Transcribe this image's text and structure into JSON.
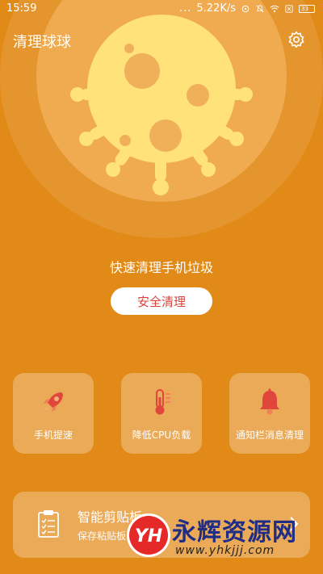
{
  "status_bar": {
    "time": "15:59",
    "dots": "...",
    "speed": "5.22K/s",
    "battery": "33"
  },
  "app": {
    "title": "清理球球"
  },
  "hero": {
    "subtitle": "快速清理手机垃圾",
    "button": "安全清理"
  },
  "features": [
    {
      "label": "手机提速",
      "icon": "rocket-icon"
    },
    {
      "label": "降低CPU负载",
      "icon": "thermometer-icon"
    },
    {
      "label": "通知栏消息清理",
      "icon": "bell-icon"
    }
  ],
  "clipboard_card": {
    "title": "智能剪贴板",
    "subtitle": "保存粘贴板",
    "icon": "clipboard-icon"
  },
  "watermark": {
    "logo": "YH",
    "name": "永辉资源网",
    "url": "www.yhkjjj.com"
  },
  "colors": {
    "background": "#E28A17",
    "accent_red": "#D7443B",
    "germ_yellow": "#FFE27A"
  }
}
